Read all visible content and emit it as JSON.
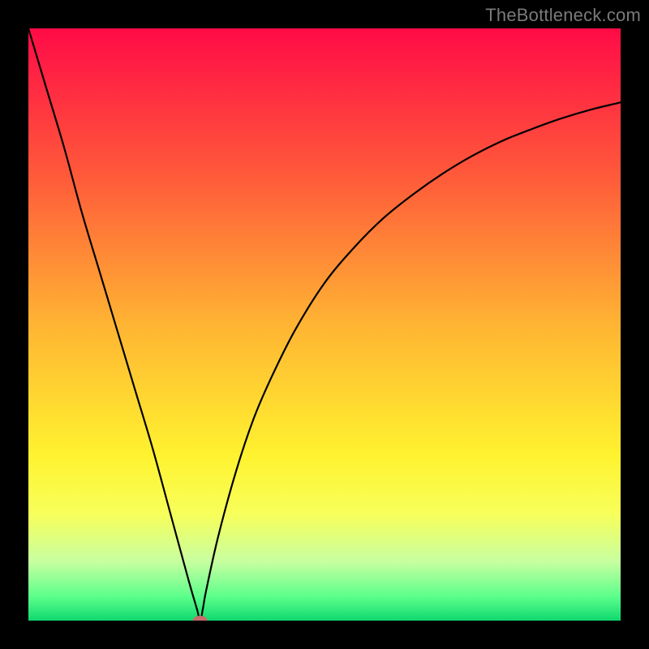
{
  "watermark": "TheBottleneck.com",
  "chart_data": {
    "type": "line",
    "title": "",
    "xlabel": "",
    "ylabel": "",
    "xlim": [
      0,
      100
    ],
    "ylim": [
      0,
      100
    ],
    "grid": false,
    "legend": false,
    "background_gradient": {
      "stops": [
        {
          "offset": 0.0,
          "color": "#ff0b47"
        },
        {
          "offset": 0.25,
          "color": "#ff5a3a"
        },
        {
          "offset": 0.5,
          "color": "#ffb433"
        },
        {
          "offset": 0.72,
          "color": "#fff22f"
        },
        {
          "offset": 0.82,
          "color": "#f7ff5a"
        },
        {
          "offset": 0.9,
          "color": "#c8ffa0"
        },
        {
          "offset": 0.96,
          "color": "#5bff8b"
        },
        {
          "offset": 1.0,
          "color": "#0fd86f"
        }
      ]
    },
    "minimum_marker": {
      "x": 29,
      "y": 0,
      "color": "#c96a6a"
    },
    "series": [
      {
        "name": "bottleneck-curve",
        "color": "#000000",
        "x": [
          0,
          3,
          6,
          9,
          12,
          15,
          18,
          21,
          24,
          27,
          28.5,
          29,
          29.5,
          30,
          32,
          35,
          38,
          41,
          45,
          50,
          55,
          60,
          65,
          70,
          75,
          80,
          85,
          90,
          95,
          100
        ],
        "y": [
          100,
          90,
          80,
          69,
          59,
          49,
          39,
          29,
          18,
          7,
          1.8,
          0,
          2.2,
          5,
          14,
          25,
          34,
          41,
          49,
          57,
          63,
          68,
          72,
          75.5,
          78.5,
          81,
          83,
          84.8,
          86.3,
          87.5
        ]
      }
    ]
  }
}
